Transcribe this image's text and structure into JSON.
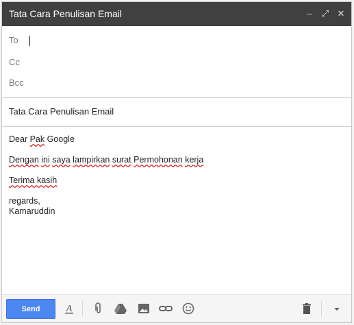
{
  "window": {
    "title": "Tata Cara Penulisan Email",
    "minimize_label": "–",
    "expand_label": "⤢",
    "close_label": "✕"
  },
  "fields": {
    "to_label": "To",
    "cc_label": "Cc",
    "bcc_label": "Bcc"
  },
  "subject": "Tata Cara Penulisan Email",
  "body": {
    "greeting_prefix": "Dear ",
    "greeting_misspelled": "Pak",
    "greeting_suffix": " Google",
    "line2_misspelled_1": "Dengan",
    "line2_text_a": " ",
    "line2_misspelled_2": "ini",
    "line2_text_b": " ",
    "line2_misspelled_3": "saya",
    "line2_text_c": " ",
    "line2_misspelled_4": "lampirkan",
    "line2_text_d": " ",
    "line2_misspelled_5": "surat",
    "line2_text_e": " ",
    "line2_misspelled_6": "Permohonan",
    "line2_text_f": " ",
    "line2_misspelled_7": "kerja",
    "thanks_misspelled": "Terima kasih",
    "signoff_1": "regards,",
    "signoff_2": "Kamaruddin"
  },
  "toolbar": {
    "send_label": "Send",
    "icons": [
      "formatting-icon",
      "attach-icon",
      "drive-icon",
      "photo-icon",
      "link-icon",
      "emoji-icon",
      "trash-icon",
      "more-options-icon"
    ]
  }
}
